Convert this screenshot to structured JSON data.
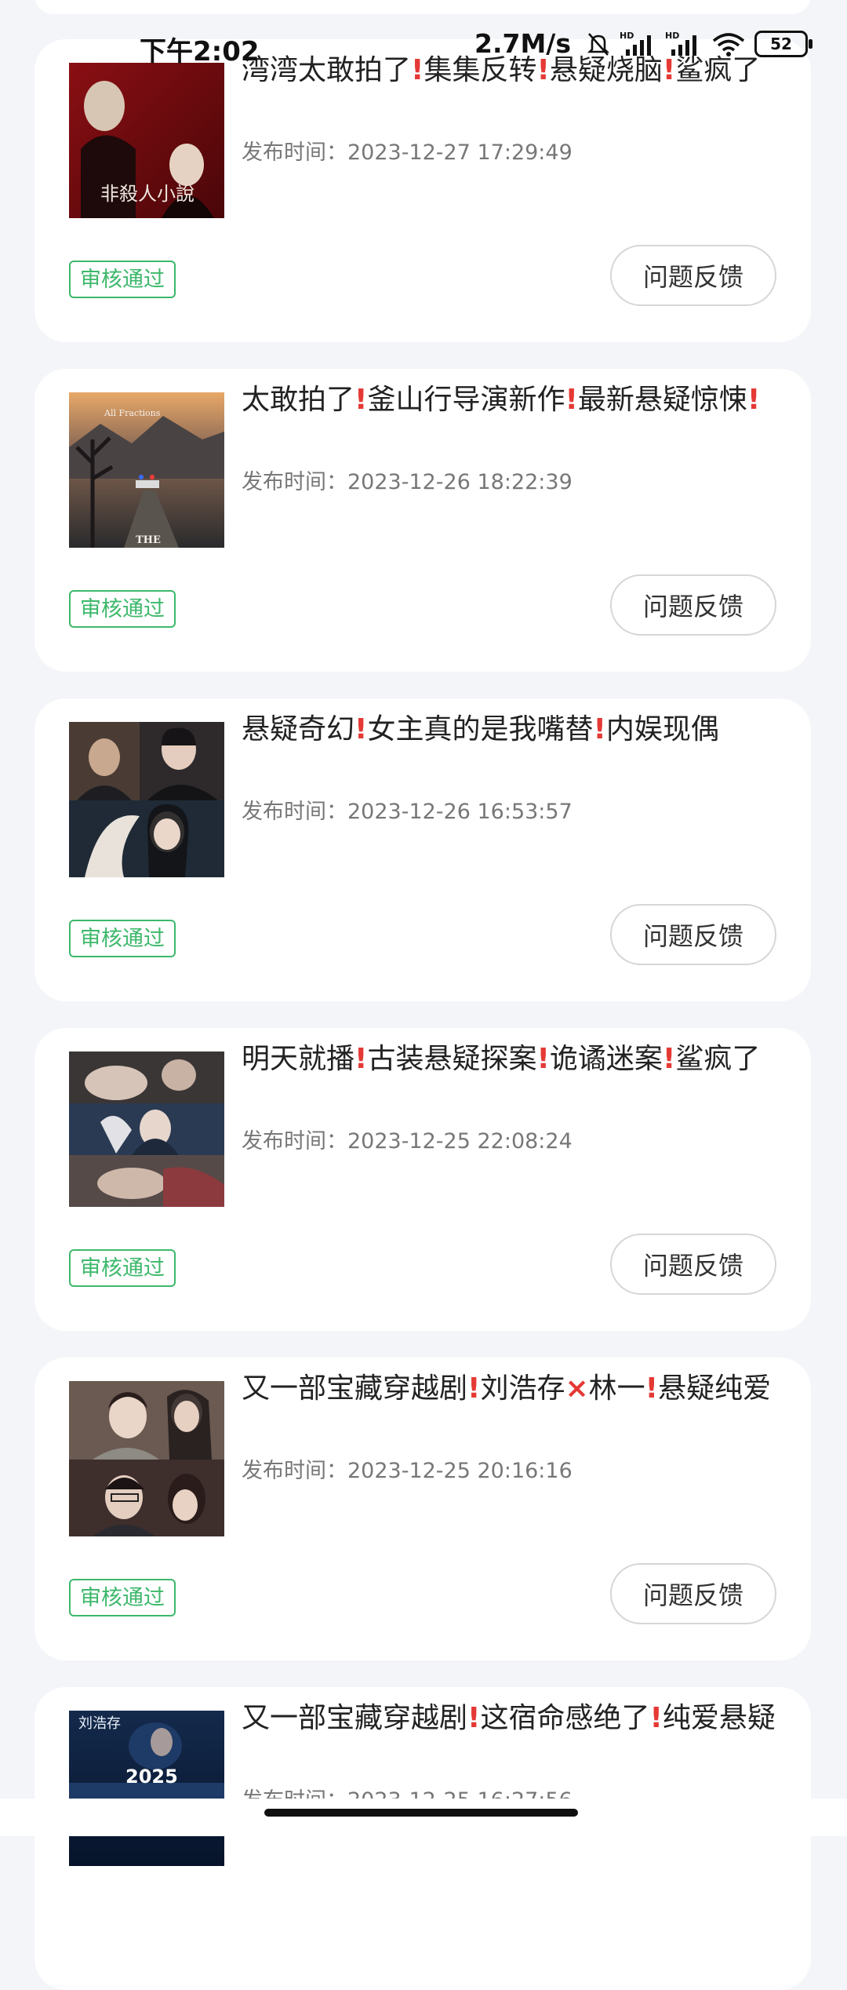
{
  "status_bar": {
    "time": "下午2:02",
    "speed": "2.7M/s",
    "battery": "52"
  },
  "feed": {
    "items": [
      {
        "title_parts": [
          "湾湾太敢拍了",
          "!",
          "集集反转",
          "!",
          "悬疑烧脑",
          "!",
          "鲨疯了"
        ],
        "publish_time": "发布时间：2023-12-27 17:29:49",
        "status": "审核通过",
        "feedback_label": "问题反馈"
      },
      {
        "title_parts": [
          "太敢拍了",
          "!",
          "釜山行导演新作",
          "!",
          "最新悬疑惊悚",
          "!"
        ],
        "publish_time": "发布时间：2023-12-26 18:22:39",
        "status": "审核通过",
        "feedback_label": "问题反馈"
      },
      {
        "title_parts": [
          "悬疑奇幻",
          "!",
          "女主真的是我嘴替",
          "!",
          "内娱现偶"
        ],
        "publish_time": "发布时间：2023-12-26 16:53:57",
        "status": "审核通过",
        "feedback_label": "问题反馈"
      },
      {
        "title_parts": [
          "明天就播",
          "!",
          "古装悬疑探案",
          "!",
          "诡谲迷案",
          "!",
          "鲨疯了"
        ],
        "publish_time": "发布时间：2023-12-25 22:08:24",
        "status": "审核通过",
        "feedback_label": "问题反馈"
      },
      {
        "title_parts": [
          "又一部宝藏穿越剧",
          "!",
          "刘浩存",
          "×",
          "林一",
          "!",
          "悬疑纯爱"
        ],
        "publish_time": "发布时间：2023-12-25 20:16:16",
        "status": "审核通过",
        "feedback_label": "问题反馈"
      },
      {
        "title_parts": [
          "又一部宝藏穿越剧",
          "!",
          "这宿命感绝了",
          "!",
          "纯爱悬疑"
        ],
        "publish_time": "发布时间：2023-12-25 16:27:56"
      }
    ]
  },
  "thumb_texts": {
    "t1": "非殺人小說",
    "t2_top": "All Fractions",
    "t2_bottom": "THE",
    "t6_name": "刘浩存",
    "t6_year": "2025"
  },
  "colors": {
    "accent_green": "#3DB86B",
    "exclaim_red": "#E53935",
    "page_bg": "#F4F5F8"
  }
}
